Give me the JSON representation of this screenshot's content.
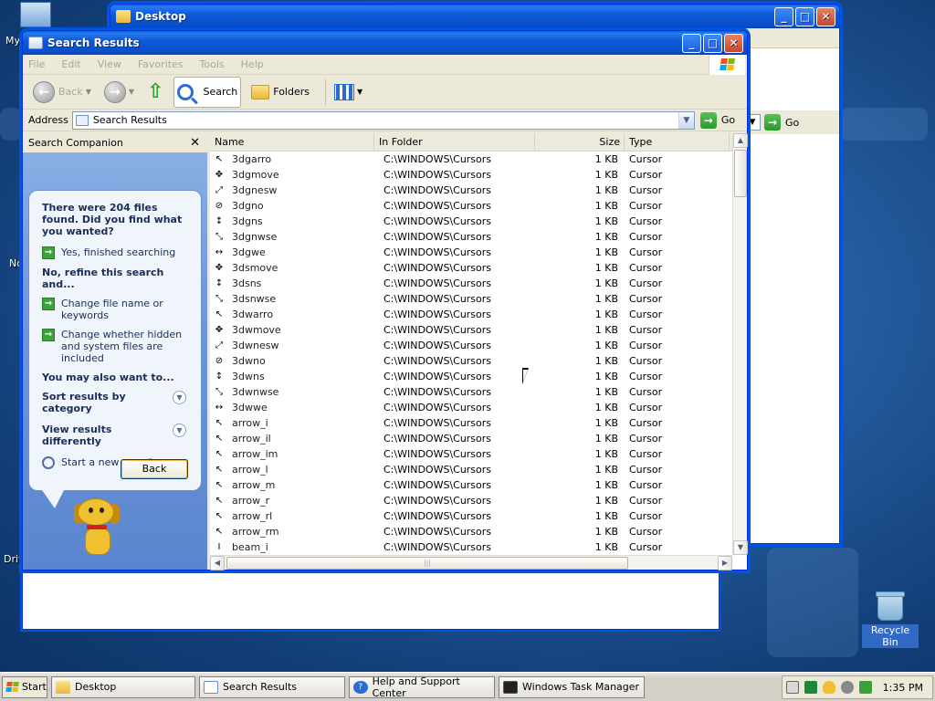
{
  "desktop": {
    "partial_labels": [
      "My",
      "No",
      "Driv"
    ],
    "recycle_bin": "Recycle Bin"
  },
  "back_window": {
    "title": "Desktop",
    "go": "Go"
  },
  "main_window": {
    "title": "Search Results",
    "menu": [
      "File",
      "Edit",
      "View",
      "Favorites",
      "Tools",
      "Help"
    ],
    "toolbar": {
      "back": "Back",
      "search": "Search",
      "folders": "Folders"
    },
    "address": {
      "label": "Address",
      "value": "Search Results",
      "go": "Go"
    }
  },
  "companion": {
    "title": "Search Companion",
    "found": "There were 204 files found. Did you find what you wanted?",
    "yes": "Yes, finished searching",
    "refine": "No, refine this search and...",
    "change_name": "Change file name or keywords",
    "change_hidden": "Change whether hidden and system files are included",
    "also": "You may also want to...",
    "sort": "Sort results by category",
    "view": "View results differently",
    "new_search": "Start a new search",
    "back": "Back"
  },
  "columns": {
    "name": "Name",
    "folder": "In Folder",
    "size": "Size",
    "type": "Type"
  },
  "rows": [
    {
      "icon": "↖",
      "name": "3dgarro",
      "folder": "C:\\WINDOWS\\Cursors",
      "size": "1 KB",
      "type": "Cursor"
    },
    {
      "icon": "✥",
      "name": "3dgmove",
      "folder": "C:\\WINDOWS\\Cursors",
      "size": "1 KB",
      "type": "Cursor"
    },
    {
      "icon": "⤢",
      "name": "3dgnesw",
      "folder": "C:\\WINDOWS\\Cursors",
      "size": "1 KB",
      "type": "Cursor"
    },
    {
      "icon": "⊘",
      "name": "3dgno",
      "folder": "C:\\WINDOWS\\Cursors",
      "size": "1 KB",
      "type": "Cursor"
    },
    {
      "icon": "↕",
      "name": "3dgns",
      "folder": "C:\\WINDOWS\\Cursors",
      "size": "1 KB",
      "type": "Cursor"
    },
    {
      "icon": "⤡",
      "name": "3dgnwse",
      "folder": "C:\\WINDOWS\\Cursors",
      "size": "1 KB",
      "type": "Cursor"
    },
    {
      "icon": "↔",
      "name": "3dgwe",
      "folder": "C:\\WINDOWS\\Cursors",
      "size": "1 KB",
      "type": "Cursor"
    },
    {
      "icon": "✥",
      "name": "3dsmove",
      "folder": "C:\\WINDOWS\\Cursors",
      "size": "1 KB",
      "type": "Cursor"
    },
    {
      "icon": "↕",
      "name": "3dsns",
      "folder": "C:\\WINDOWS\\Cursors",
      "size": "1 KB",
      "type": "Cursor"
    },
    {
      "icon": "⤡",
      "name": "3dsnwse",
      "folder": "C:\\WINDOWS\\Cursors",
      "size": "1 KB",
      "type": "Cursor"
    },
    {
      "icon": "↖",
      "name": "3dwarro",
      "folder": "C:\\WINDOWS\\Cursors",
      "size": "1 KB",
      "type": "Cursor"
    },
    {
      "icon": "✥",
      "name": "3dwmove",
      "folder": "C:\\WINDOWS\\Cursors",
      "size": "1 KB",
      "type": "Cursor"
    },
    {
      "icon": "⤢",
      "name": "3dwnesw",
      "folder": "C:\\WINDOWS\\Cursors",
      "size": "1 KB",
      "type": "Cursor"
    },
    {
      "icon": "⊘",
      "name": "3dwno",
      "folder": "C:\\WINDOWS\\Cursors",
      "size": "1 KB",
      "type": "Cursor"
    },
    {
      "icon": "↕",
      "name": "3dwns",
      "folder": "C:\\WINDOWS\\Cursors",
      "size": "1 KB",
      "type": "Cursor"
    },
    {
      "icon": "⤡",
      "name": "3dwnwse",
      "folder": "C:\\WINDOWS\\Cursors",
      "size": "1 KB",
      "type": "Cursor"
    },
    {
      "icon": "↔",
      "name": "3dwwe",
      "folder": "C:\\WINDOWS\\Cursors",
      "size": "1 KB",
      "type": "Cursor"
    },
    {
      "icon": "↖",
      "name": "arrow_i",
      "folder": "C:\\WINDOWS\\Cursors",
      "size": "1 KB",
      "type": "Cursor"
    },
    {
      "icon": "↖",
      "name": "arrow_il",
      "folder": "C:\\WINDOWS\\Cursors",
      "size": "1 KB",
      "type": "Cursor"
    },
    {
      "icon": "↖",
      "name": "arrow_im",
      "folder": "C:\\WINDOWS\\Cursors",
      "size": "1 KB",
      "type": "Cursor"
    },
    {
      "icon": "↖",
      "name": "arrow_l",
      "folder": "C:\\WINDOWS\\Cursors",
      "size": "1 KB",
      "type": "Cursor"
    },
    {
      "icon": "↖",
      "name": "arrow_m",
      "folder": "C:\\WINDOWS\\Cursors",
      "size": "1 KB",
      "type": "Cursor"
    },
    {
      "icon": "↖",
      "name": "arrow_r",
      "folder": "C:\\WINDOWS\\Cursors",
      "size": "1 KB",
      "type": "Cursor"
    },
    {
      "icon": "↖",
      "name": "arrow_rl",
      "folder": "C:\\WINDOWS\\Cursors",
      "size": "1 KB",
      "type": "Cursor"
    },
    {
      "icon": "↖",
      "name": "arrow_rm",
      "folder": "C:\\WINDOWS\\Cursors",
      "size": "1 KB",
      "type": "Cursor"
    },
    {
      "icon": "I",
      "name": "beam_i",
      "folder": "C:\\WINDOWS\\Cursors",
      "size": "1 KB",
      "type": "Cursor"
    }
  ],
  "taskbar": {
    "start": "Start",
    "tasks": [
      "Desktop",
      "Search Results",
      "Help and Support Center",
      "Windows Task Manager"
    ],
    "clock": "1:35 PM"
  },
  "colors": {
    "title_blue": "#0a5ddc",
    "taskbar_gray": "#d4d0c8",
    "companion_blue": "#6f98db"
  }
}
